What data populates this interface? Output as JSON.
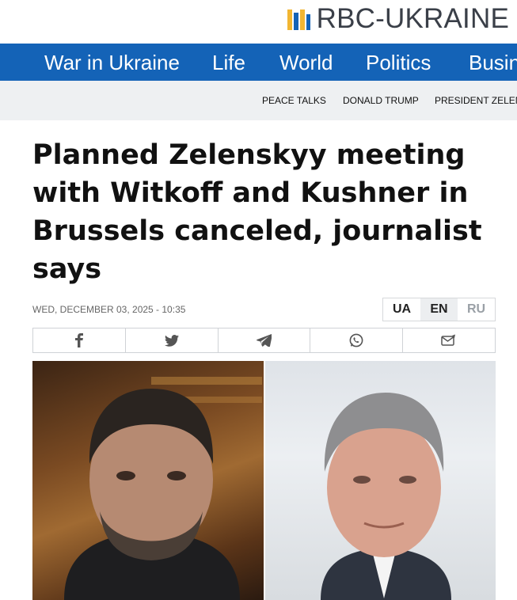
{
  "site": {
    "logo_text": "RBC-UKRAINE",
    "brand_color": "#1463b7"
  },
  "main_nav": {
    "items": [
      "War in Ukraine",
      "Life",
      "World",
      "Politics",
      "Busin"
    ]
  },
  "sub_nav": {
    "tags": [
      "PEACE TALKS",
      "DONALD TRUMP",
      "PRESIDENT ZELENS"
    ]
  },
  "article": {
    "title": "Planned Zelenskyy meeting with Witkoff and Kushner in Brussels canceled, journalist says",
    "date": "WED, DECEMBER 03, 2025 - 10:35"
  },
  "languages": {
    "ua": "UA",
    "en": "EN",
    "ru": "RU",
    "active": "EN"
  },
  "share": {
    "icons": [
      "facebook-icon",
      "twitter-icon",
      "telegram-icon",
      "whatsapp-icon",
      "email-icon"
    ]
  }
}
